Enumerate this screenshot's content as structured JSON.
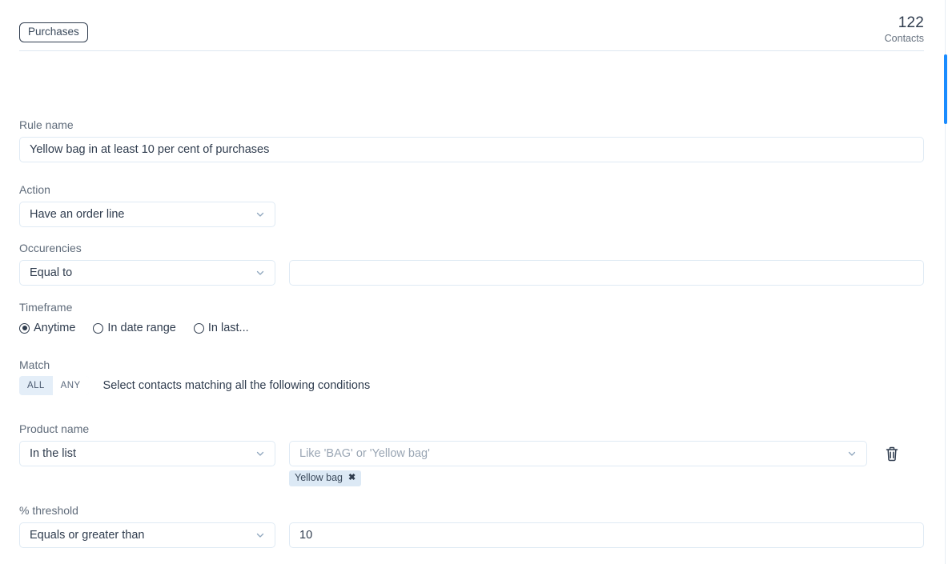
{
  "header": {
    "tag_label": "Purchases",
    "count_number": "122",
    "count_label": "Contacts"
  },
  "form": {
    "rule_name": {
      "label": "Rule name",
      "value": "Yellow bag in at least 10 per cent of purchases",
      "placeholder": "Rule name"
    },
    "action": {
      "label": "Action",
      "value": "Have an order line",
      "icon": "chevron-down-icon"
    },
    "occurencies": {
      "label": "Occurencies",
      "operator_value": "Equal to",
      "amount_value": "",
      "amount_placeholder": "",
      "icon": "chevron-down-icon"
    },
    "timeframe": {
      "label": "Timeframe",
      "options": [
        {
          "label": "Anytime",
          "selected": true
        },
        {
          "label": "In date range",
          "selected": false
        },
        {
          "label": "In last...",
          "selected": false
        }
      ]
    },
    "match": {
      "label": "Match",
      "all_label": "ALL",
      "any_label": "ANY",
      "selected": "ALL",
      "description": "Select contacts matching all the following conditions"
    },
    "product_name": {
      "label": "Product name",
      "operator_value": "In the list",
      "value_placeholder": "Like 'BAG' or 'Yellow bag'",
      "value_text": "",
      "chips": [
        {
          "label": "Yellow bag",
          "remove_icon": "close-icon"
        }
      ],
      "delete_icon": "trash-icon",
      "icon": "chevron-down-icon"
    },
    "threshold": {
      "label": "% threshold",
      "operator_value": "Equals or greater than",
      "amount_value": "10",
      "amount_placeholder": "",
      "icon": "chevron-down-icon"
    }
  },
  "scrollbar": {
    "name": "vertical-scrollbar"
  },
  "colors": {
    "accent": "#1a8cff",
    "border": "#dfeaf4",
    "text": "#2f3c4e",
    "muted": "#5f6b7a",
    "chip_bg": "#dce9f5"
  }
}
